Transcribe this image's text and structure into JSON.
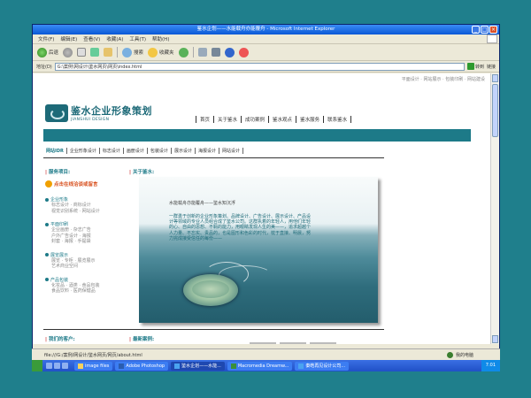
{
  "window": {
    "title": "鉴水企划——水能载舟亦能覆舟 - Microsoft Internet Explorer"
  },
  "menubar": {
    "items": [
      "文件(F)",
      "编辑(E)",
      "查看(V)",
      "收藏(A)",
      "工具(T)",
      "帮助(H)"
    ]
  },
  "toolbar": {
    "back": "后退",
    "search": "搜索",
    "favorites": "收藏夹"
  },
  "addressbar": {
    "label": "地址(D)",
    "url": "G:\\案例\\网设计\\鉴水网页\\网页\\index.html",
    "go": "转到",
    "links": "链接"
  },
  "site": {
    "toplinks": "平面设计 · 网站展示 · 包装印刷 · 网站建设",
    "logo_cn": "鉴水企业形象策划",
    "logo_en": "JIANSHUI DESIGN",
    "nav": [
      "首页",
      "关于鉴水",
      "成功案例",
      "鉴水观点",
      "鉴水服务",
      "联系鉴水"
    ],
    "subnav": [
      "网站IDR",
      "企业形象设计",
      "标志设计",
      "画册设计",
      "包装设计",
      "展示设计",
      "海报设计",
      "网站设计"
    ],
    "left_title": "服务项目:",
    "contact": "点击在线洽谈或留言",
    "services": [
      {
        "head": "企业形象",
        "sub": [
          "标志设计 · 商标设计",
          "视觉识别系统 · 网站设计"
        ]
      },
      {
        "head": "平面印刷",
        "sub": [
          "企业画册 · 杂志广告",
          "户外广告设计 · 海报",
          "封套 · 海报 · 手提袋"
        ]
      },
      {
        "head": "展览展示",
        "sub": [
          "展览 · 专柜 · 展览展示",
          "艺术商业空间"
        ]
      },
      {
        "head": "产品包装",
        "sub": [
          "化妆品 · 酒类 · 食品包装",
          "食品饮料 · 医药保健品"
        ]
      }
    ],
    "about_title": "关于鉴水:",
    "hero_title": "水能载舟亦能覆舟——鉴水知沉浮",
    "hero_text": "一群勇于创新的企业形象策划、品牌设计、广告设计、展示设计、产品设计等领域的专业人员组合成了鉴水公司。这群执着的年轻人，用他们年轻的心、自由的思想、不羁的能力，用眼睛发现人生的美——，追求超越个人力量、不忘实、贵品的，也是图形和色彩的时代，枕于直接、明晨，努力完成接受信任的每份——",
    "clients_title": "我们的客户:",
    "cases_title": "最新案例:"
  },
  "status": {
    "text": "file:///G:/案例/网设计/鉴水网页/网页/about.html",
    "zone": "我的电脑"
  },
  "taskbar": {
    "tasks": [
      "image files",
      "Adobe Photoshop",
      "鉴水企划——水能...",
      "Macromedia Dreamw...",
      "秦皓再见设计公司..."
    ],
    "clock": "7:01"
  }
}
